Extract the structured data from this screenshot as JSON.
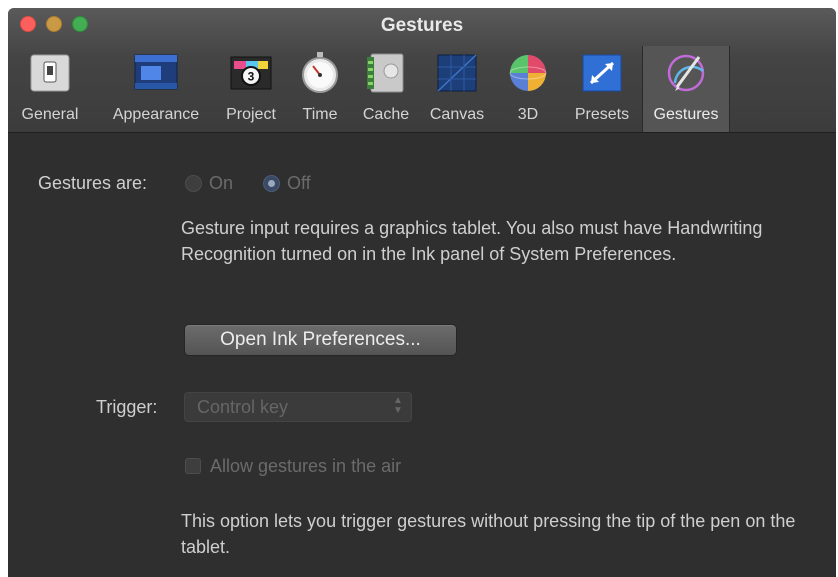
{
  "window": {
    "title": "Gestures"
  },
  "toolbar": {
    "tabs": [
      {
        "label": "General",
        "icon": "general-switch-icon"
      },
      {
        "label": "Appearance",
        "icon": "appearance-window-icon"
      },
      {
        "label": "Project",
        "icon": "project-clapper-icon"
      },
      {
        "label": "Time",
        "icon": "stopwatch-icon"
      },
      {
        "label": "Cache",
        "icon": "cache-drive-icon"
      },
      {
        "label": "Canvas",
        "icon": "canvas-grid-icon"
      },
      {
        "label": "3D",
        "icon": "3d-sphere-icon"
      },
      {
        "label": "Presets",
        "icon": "presets-arrow-icon"
      },
      {
        "label": "Gestures",
        "icon": "gestures-pen-icon",
        "selected": true
      }
    ]
  },
  "gestures": {
    "label": "Gestures are:",
    "on_label": "On",
    "off_label": "Off",
    "selected": "Off",
    "description": "Gesture input requires a graphics tablet. You also must have Handwriting Recognition turned on in the Ink panel of System Preferences.",
    "open_ink_button": "Open Ink Preferences..."
  },
  "trigger": {
    "label": "Trigger:",
    "value": "Control key"
  },
  "air": {
    "checkbox_label": "Allow gestures in the air",
    "checked": false,
    "description": "This option lets you trigger gestures without pressing the tip of the pen on the tablet."
  },
  "colors": {
    "background": "#2f2f2f",
    "toolbar": "#444444",
    "selected_tab": "#555555",
    "text": "#cfcfcf",
    "disabled_text": "#6b6b6b"
  }
}
